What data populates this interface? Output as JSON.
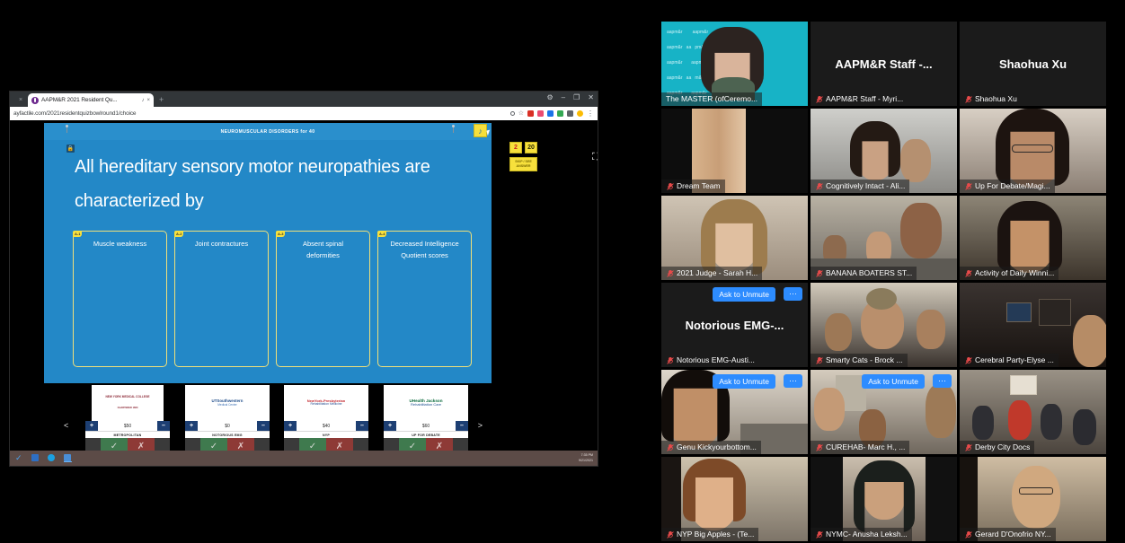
{
  "browser": {
    "tab_title": "AAPM&R 2021 Resident Qu...",
    "tab_close": "×",
    "tab_audio": "♪",
    "new_tab": "+",
    "ghost_tab": "×",
    "url": "ayfactile.com/2021residentquizbowlround1/choice",
    "window_controls": {
      "settings": "⚙",
      "minimize": "–",
      "maximize": "❐",
      "close": "✕"
    },
    "omni_icons": [
      "search-icon",
      "bookmark-star-icon",
      "extension-red-icon",
      "extension-pink-icon",
      "extension-blue-icon",
      "extension-green-icon",
      "extension-pin-icon",
      "profile-avatar-icon",
      "chrome-menu-icon"
    ]
  },
  "game": {
    "header_title": "NEUROMUSCULAR DISORDERS for 40",
    "note_icon": "♪",
    "lock_icon": "🔒",
    "question": "All hereditary sensory motor neuropathies are characterized by",
    "answers": [
      {
        "tag": "A-1",
        "text": "Muscle weakness"
      },
      {
        "tag": "A-2",
        "text": "Joint contractures"
      },
      {
        "tag": "A-3",
        "text": "Absent spinal deformities"
      },
      {
        "tag": "A-4",
        "text": "Decreased Intelligence Quotient scores"
      }
    ],
    "chips": {
      "count": "2",
      "timer": "20",
      "skip_label": "SKIP / SEE ANSWER"
    },
    "expand_icon": "⛶",
    "nav_prev": "<",
    "nav_next": ">",
    "teams": [
      {
        "name": "METROPOLITAN",
        "score": "$50",
        "logo_line1": "NEW YORK MEDICAL COLLEGE",
        "logo_line2": "CHARTERED 1860",
        "plus": "+",
        "minus": "–",
        "ok": "✓",
        "no": "✗"
      },
      {
        "name": "NOTORIOUS EMG",
        "score": "$0",
        "logo_line1": "UTSouthwestern",
        "logo_line2": "Medical Center",
        "plus": "+",
        "minus": "–",
        "ok": "✓",
        "no": "✗"
      },
      {
        "name": "NYP",
        "score": "$40",
        "logo_line1": "NewYork-Presbyterian",
        "logo_line2": "Rehabilitation Medicine",
        "plus": "+",
        "minus": "–",
        "ok": "✓",
        "no": "✗"
      },
      {
        "name": "UP FOR DEBATE",
        "score": "$60",
        "logo_line1": "UHealth  Jackson",
        "logo_line2": "Rehabilitation Care",
        "plus": "+",
        "minus": "–",
        "ok": "✓",
        "no": "✗"
      }
    ]
  },
  "taskbar": {
    "icons": [
      "todo-check-icon",
      "outlook-icon",
      "edge-icon",
      "app-window-icon"
    ],
    "time": "7:35 PM",
    "date": "9/21/2021"
  },
  "zoom_gallery": {
    "ask_to_unmute": "Ask to Unmute",
    "more_options": "···",
    "tiles": [
      {
        "label": "The MASTER (ofCeremo...",
        "big": "",
        "active": true,
        "muted": false,
        "ask": false,
        "style": "mc"
      },
      {
        "label": "AAPM&R Staff - Myri...",
        "big": "AAPM&R Staff -...",
        "active": false,
        "muted": true,
        "ask": false,
        "style": "audio"
      },
      {
        "label": "Shaohua Xu",
        "big": "Shaohua Xu",
        "active": false,
        "muted": true,
        "ask": false,
        "style": "audio"
      },
      {
        "label": "Dream Team",
        "big": "",
        "active": false,
        "muted": true,
        "ask": false,
        "style": "v-dream"
      },
      {
        "label": "Cognitively Intact - Ali...",
        "big": "",
        "active": false,
        "muted": true,
        "ask": false,
        "style": "v-cog"
      },
      {
        "label": "Up For Debate/Magi...",
        "big": "",
        "active": false,
        "muted": true,
        "ask": false,
        "style": "v-upfor"
      },
      {
        "label": "2021 Judge - Sarah H...",
        "big": "",
        "active": false,
        "muted": true,
        "ask": false,
        "style": "v-judge"
      },
      {
        "label": "BANANA BOATERS ST...",
        "big": "",
        "active": false,
        "muted": true,
        "ask": false,
        "style": "v-banana"
      },
      {
        "label": "Activity of Daily Winni...",
        "big": "",
        "active": false,
        "muted": true,
        "ask": false,
        "style": "v-adw"
      },
      {
        "label": "Notorious EMG-Austi...",
        "big": "Notorious  EMG-...",
        "active": false,
        "muted": true,
        "ask": true,
        "style": "audio"
      },
      {
        "label": "Smarty Cats - Brock ...",
        "big": "",
        "active": false,
        "muted": true,
        "ask": false,
        "style": "v-smarty"
      },
      {
        "label": "Cerebral Party-Elyse ...",
        "big": "",
        "active": false,
        "muted": true,
        "ask": false,
        "style": "v-cerebral"
      },
      {
        "label": "Genu Kickyourbottom...",
        "big": "",
        "active": false,
        "muted": true,
        "ask": true,
        "style": "v-genu"
      },
      {
        "label": "CUREHAB- Marc H., ...",
        "big": "",
        "active": false,
        "muted": true,
        "ask": true,
        "style": "v-curehab"
      },
      {
        "label": "Derby City Docs",
        "big": "",
        "active": false,
        "muted": true,
        "ask": false,
        "style": "v-derby"
      },
      {
        "label": "NYP Big Apples - (Te...",
        "big": "",
        "active": false,
        "muted": true,
        "ask": false,
        "style": "v-nyp"
      },
      {
        "label": "NYMC- Anusha Leksh...",
        "big": "",
        "active": false,
        "muted": true,
        "ask": false,
        "style": "v-nymc"
      },
      {
        "label": "Gerard D'Onofrio NY...",
        "big": "",
        "active": false,
        "muted": true,
        "ask": false,
        "style": "v-gerard"
      }
    ]
  },
  "colors": {
    "board_blue": "#2388c7",
    "accent_yellow": "#f7e03c",
    "zoom_blue": "#2d8cff",
    "active_outline": "#f4f48a"
  }
}
